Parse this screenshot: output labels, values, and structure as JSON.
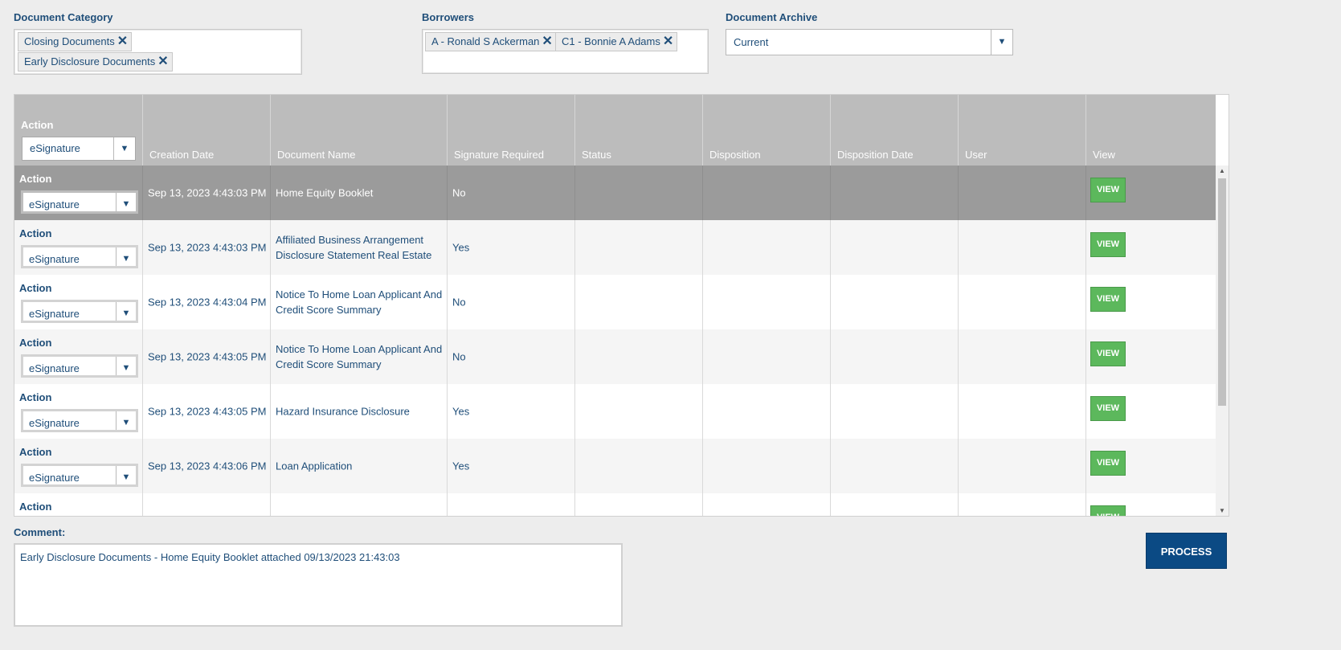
{
  "filters": {
    "category_label": "Document Category",
    "category_tags": [
      "Closing Documents",
      "Early Disclosure Documents"
    ],
    "borrowers_label": "Borrowers",
    "borrower_tags": [
      "A - Ronald S Ackerman",
      "C1 - Bonnie A Adams"
    ],
    "archive_label": "Document Archive",
    "archive_value": "Current",
    "remove_glyph": "✕",
    "dropdown_glyph": "▼"
  },
  "grid": {
    "header": {
      "action_label": "Action",
      "action_value": "eSignature",
      "columns": [
        "Creation Date",
        "Document Name",
        "Signature Required",
        "Status",
        "Disposition",
        "Disposition Date",
        "User",
        "View"
      ]
    },
    "rows": [
      {
        "action_label": "Action",
        "action_value": "eSignature",
        "creation_date": "Sep 13, 2023 4:43:03 PM",
        "document_name": "Home Equity Booklet",
        "signature_required": "No",
        "status": "",
        "disposition": "",
        "disposition_date": "",
        "user": "",
        "view_label": "VIEW",
        "selected": true
      },
      {
        "action_label": "Action",
        "action_value": "eSignature",
        "creation_date": "Sep 13, 2023 4:43:03 PM",
        "document_name": "Affiliated Business Arrangement Disclosure Statement Real Estate",
        "signature_required": "Yes",
        "status": "",
        "disposition": "",
        "disposition_date": "",
        "user": "",
        "view_label": "VIEW",
        "selected": false
      },
      {
        "action_label": "Action",
        "action_value": "eSignature",
        "creation_date": "Sep 13, 2023 4:43:04 PM",
        "document_name": "Notice To Home Loan Applicant And Credit Score Summary",
        "signature_required": "No",
        "status": "",
        "disposition": "",
        "disposition_date": "",
        "user": "",
        "view_label": "VIEW",
        "selected": false
      },
      {
        "action_label": "Action",
        "action_value": "eSignature",
        "creation_date": "Sep 13, 2023 4:43:05 PM",
        "document_name": "Notice To Home Loan Applicant And Credit Score Summary",
        "signature_required": "No",
        "status": "",
        "disposition": "",
        "disposition_date": "",
        "user": "",
        "view_label": "VIEW",
        "selected": false
      },
      {
        "action_label": "Action",
        "action_value": "eSignature",
        "creation_date": "Sep 13, 2023 4:43:05 PM",
        "document_name": "Hazard Insurance Disclosure",
        "signature_required": "Yes",
        "status": "",
        "disposition": "",
        "disposition_date": "",
        "user": "",
        "view_label": "VIEW",
        "selected": false
      },
      {
        "action_label": "Action",
        "action_value": "eSignature",
        "creation_date": "Sep 13, 2023 4:43:06 PM",
        "document_name": "Loan Application",
        "signature_required": "Yes",
        "status": "",
        "disposition": "",
        "disposition_date": "",
        "user": "",
        "view_label": "VIEW",
        "selected": false
      },
      {
        "action_label": "Action",
        "action_value": "",
        "creation_date": "",
        "document_name": "",
        "signature_required": "",
        "status": "",
        "disposition": "",
        "disposition_date": "",
        "user": "",
        "view_label": "VIEW",
        "selected": false
      }
    ]
  },
  "comment": {
    "label": "Comment:",
    "value": "Early Disclosure Documents - Home Equity Booklet attached 09/13/2023 21:43:03"
  },
  "process_label": "PROCESS",
  "colors": {
    "accent": "#1f4e79",
    "header_bg": "#bcbcbc",
    "selected_row_bg": "#9b9b9b",
    "alt_row_bg": "#f5f5f5",
    "view_button": "#5cb85c",
    "process_button": "#0b4a84"
  },
  "icons": [
    "close-icon",
    "chevron-down-icon",
    "scroll-up-icon",
    "scroll-down-icon"
  ]
}
